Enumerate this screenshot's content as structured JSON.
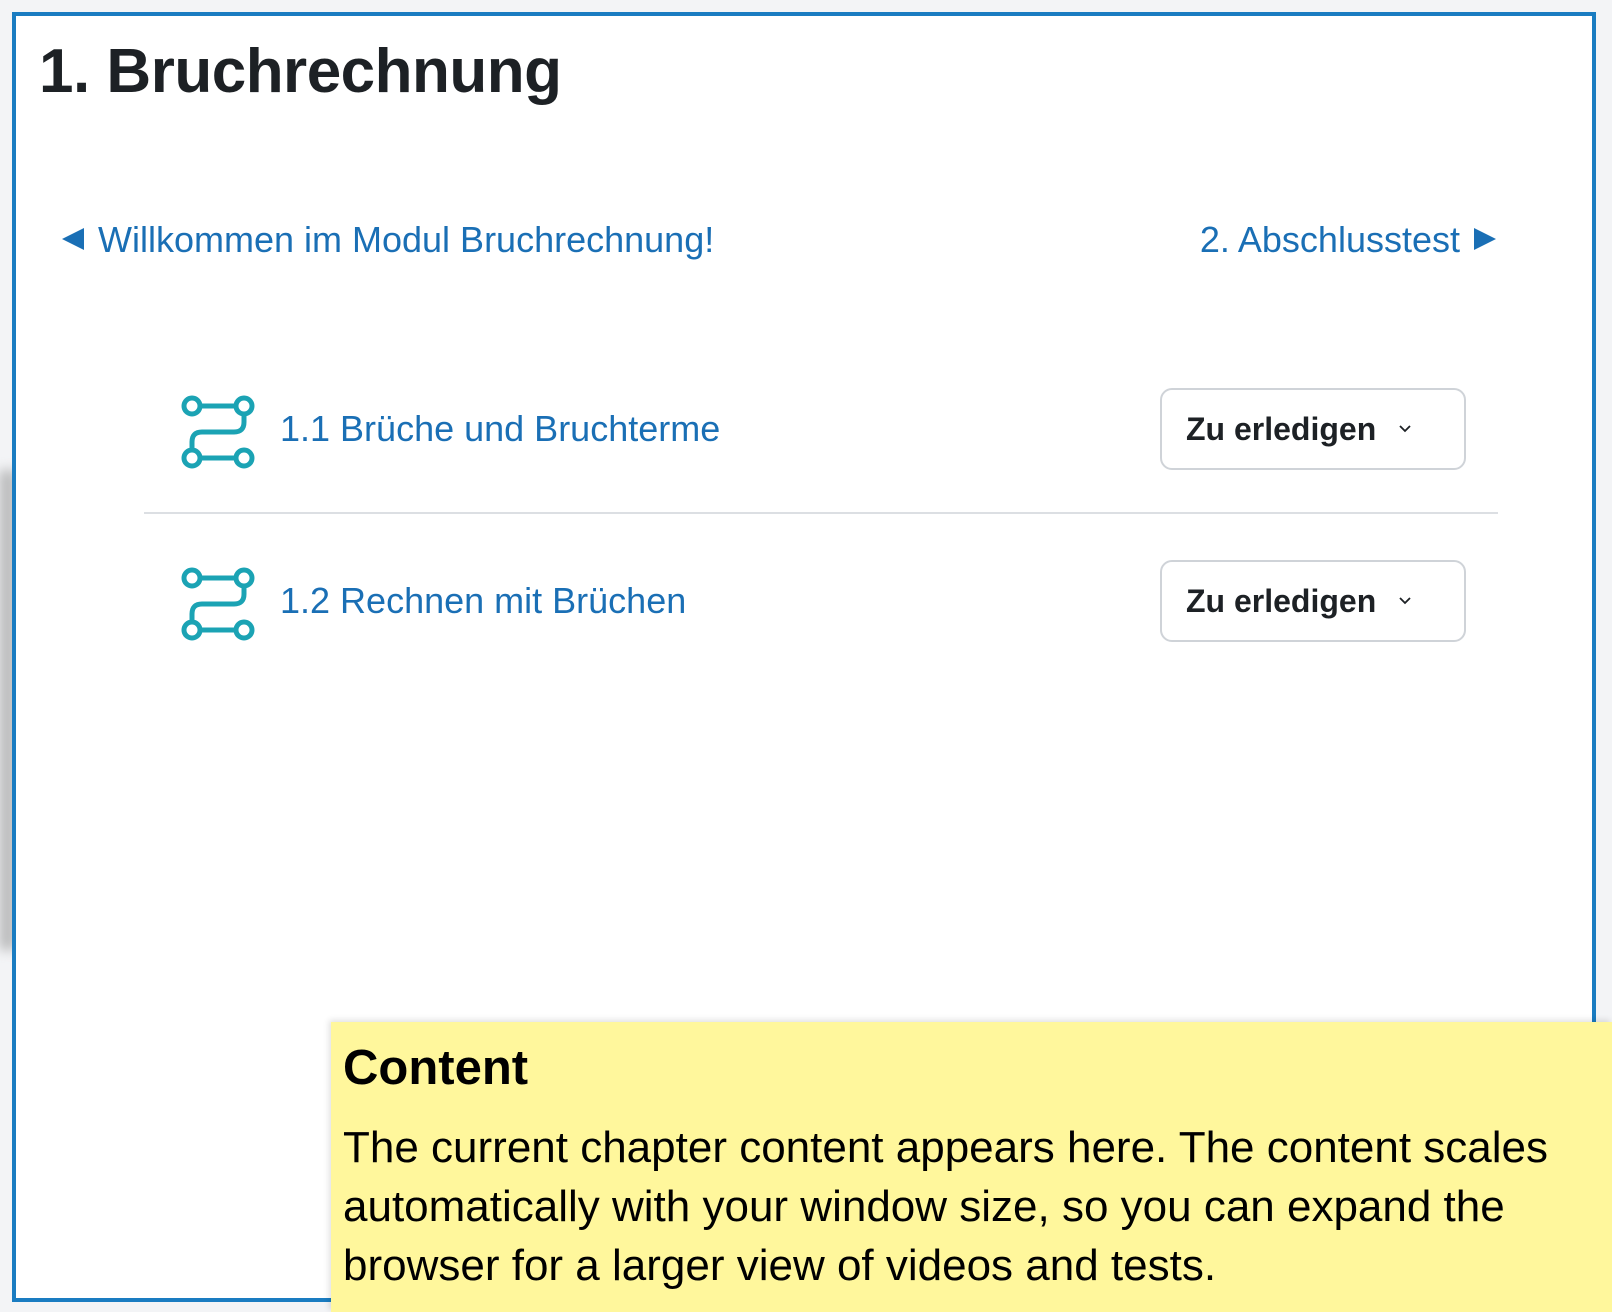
{
  "page": {
    "title": "1. Bruchrechnung"
  },
  "navigation": {
    "prev_label": "Willkommen im Modul Bruchrechnung!",
    "next_label": "2. Abschlusstest",
    "prev_icon": "triangle-left-icon",
    "next_icon": "triangle-right-icon"
  },
  "activities": [
    {
      "icon": "learning-path-icon",
      "label": "1.1 Brüche und Bruchterme",
      "status": "Zu erledigen"
    },
    {
      "icon": "learning-path-icon",
      "label": "1.2 Rechnen mit Brüchen",
      "status": "Zu erledigen"
    }
  ],
  "tooltip": {
    "title": "Content",
    "body": "The current chapter content appears here. The content scales automatically with your window size, so you can expand the browser for a larger view of videos and tests."
  },
  "colors": {
    "frame_border": "#1a7cc1",
    "link": "#1a6fb5",
    "icon_teal": "#1ba3b4",
    "tooltip_bg": "#fff79c"
  }
}
